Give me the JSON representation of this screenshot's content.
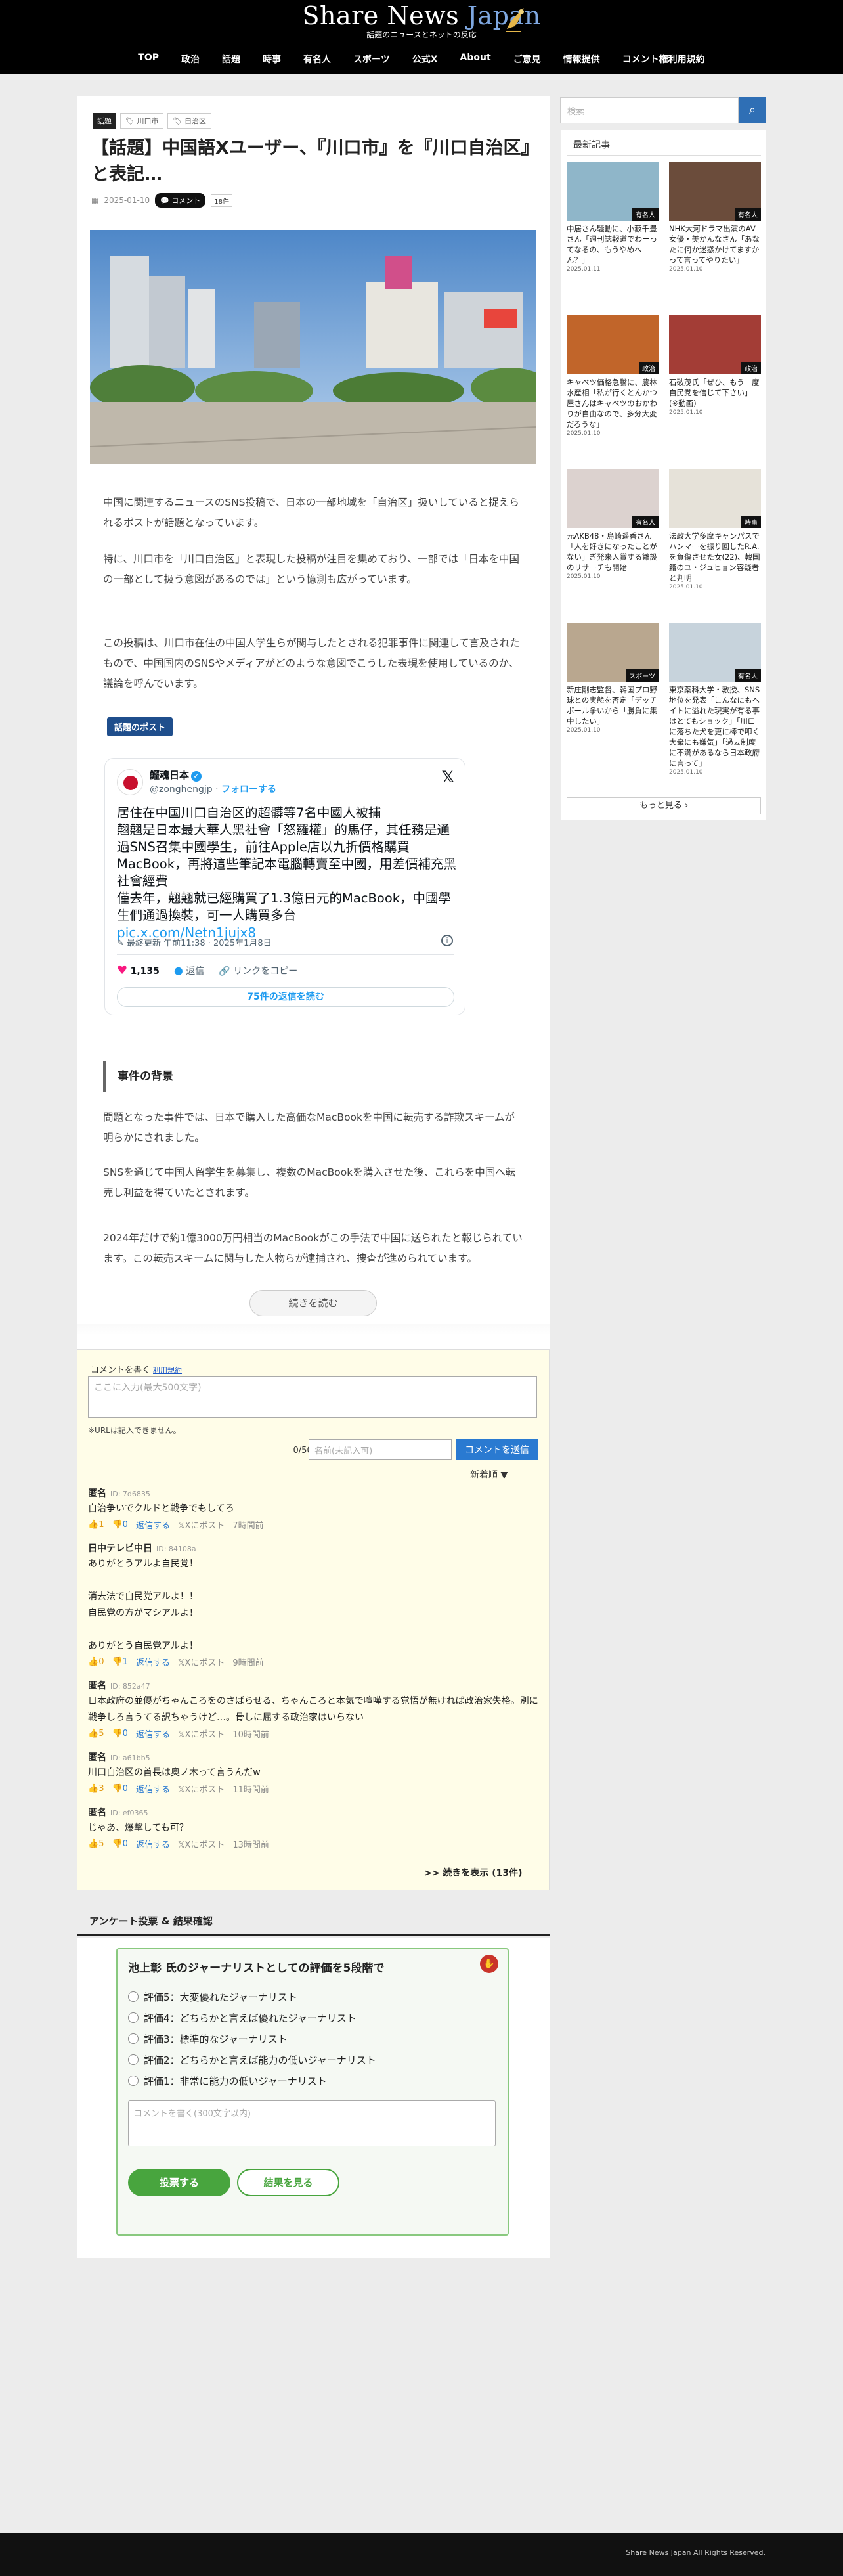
{
  "site": {
    "title_main": "Share News ",
    "title_accent": "Japan",
    "subtitle": "話題のニュースとネットの反応"
  },
  "nav": [
    "TOP",
    "政治",
    "話題",
    "時事",
    "有名人",
    "スポーツ",
    "公式X",
    "About",
    "ご意見",
    "情報提供",
    "コメント権利用規約"
  ],
  "article": {
    "category": "話題",
    "tags": [
      "川口市",
      "自治区"
    ],
    "title": "【話題】中国語Xユーザー、『川口市』を『川口自治区』と表記…",
    "date": "2025-01-10",
    "comment_label": "コメント",
    "comment_count": "18件",
    "paragraphs": [
      "中国に関連するニュースのSNS投稿で、日本の一部地域を「自治区」扱いしていると捉えられるポストが話題となっています。",
      "特に、川口市を「川口自治区」と表現した投稿が注目を集めており、一部では「日本を中国の一部として扱う意図があるのでは」という憶測も広がっています。",
      "この投稿は、川口市在住の中国人学生らが関与したとされる犯罪事件に関連して言及されたもので、中国国内のSNSやメディアがどのような意図でこうした表現を使用しているのか、議論を呼んでいます。"
    ],
    "topic_label": "話題のポスト",
    "section_heading": "事件の背景",
    "background_paragraphs": [
      "問題となった事件では、日本で購入した高価なMacBookを中国に転売する詐欺スキームが明らかにされました。",
      "SNSを通じて中国人留学生を募集し、複数のMacBookを購入させた後、これらを中国へ転売し利益を得ていたとされます。",
      "2024年だけで約1億3000万円相当のMacBookがこの手法で中国に送られたと報じられています。この転売スキームに関与した人物らが逮捕され、捜査が進められています。"
    ],
    "read_more": "続きを読む"
  },
  "tweet": {
    "name": "鰹魂日本",
    "handle": "@zonghengjp",
    "follow": "フォローする",
    "text": "居住在中国川口自治区的超髒等7名中國人被捕\n翹翹是日本最大華人黑社會「怒羅權」的馬仔，其任務是通過SNS召集中國學生，前往Apple店以九折價格購買MacBook，再將這些筆記本電腦轉賣至中國，用差價補充黑社會經費\n僅去年，翹翹就已經購買了1.3億日元的MacBook，中國學生們通過換裝，可一人購買多台",
    "link": "pic.x.com/Netn1jujx8",
    "time": "最終更新 午前11:38 · 2025年1月8日",
    "likes": "1,135",
    "reply": "返信",
    "copy_link": "リンクをコピー",
    "read_replies": "75件の返信を読む"
  },
  "comments": {
    "header": "コメントを書く",
    "rules_link": "利用規約",
    "placeholder": "ここに入力(最大500文字)",
    "url_note": "※URLは記入できません。",
    "counter": "0/500",
    "name_placeholder": "名前(未記入可)",
    "submit": "コメントを送信",
    "sort": "新着順 ▼",
    "reply_label": "返信する",
    "xpost_label": "Xにポスト",
    "items": [
      {
        "name": "匿名",
        "id": "ID: 7d6835",
        "body": "自治争いでクルドと戦争でもしてろ",
        "up": "1",
        "down": "0",
        "time": "7時間前"
      },
      {
        "name": "日中テレビ中日",
        "id": "ID: 84108a",
        "body": "ありがとうアルよ自民党！\n\n消去法で自民党アルよ！！\n自民党の方がマシアルよ！\n\nありがとう自民党アルよ！",
        "up": "0",
        "down": "1",
        "time": "9時間前"
      },
      {
        "name": "匿名",
        "id": "ID: 852a47",
        "body": "日本政府の並優がちゃんころをのさばらせる、ちゃんころと本気で喧嘩する覚悟が無ければ政治家失格。別に戦争しろ言うてる訳ちゃうけど…。骨しに屈する政治家はいらない",
        "up": "5",
        "down": "0",
        "time": "10時間前"
      },
      {
        "name": "匿名",
        "id": "ID: a61bb5",
        "body": "川口自治区の首長は奥ノ木って言うんだw",
        "up": "3",
        "down": "0",
        "time": "11時間前"
      },
      {
        "name": "匿名",
        "id": "ID: ef0365",
        "body": "じゃあ、爆撃しても可？",
        "up": "5",
        "down": "0",
        "time": "13時間前"
      }
    ],
    "more": ">> 続きを表示 (13件)"
  },
  "poll": {
    "heading": "アンケート投票 & 結果確認",
    "question": "池上彰 氏のジャーナリストとしての評価を5段階で",
    "options": [
      "評価5：大変優れたジャーナリスト",
      "評価4：どちらかと言えば優れたジャーナリスト",
      "評価3：標準的なジャーナリスト",
      "評価2：どちらかと言えば能力の低いジャーナリスト",
      "評価1：非常に能力の低いジャーナリスト"
    ],
    "comment_placeholder": "コメントを書く(300文字以内)",
    "vote": "投票する",
    "results": "結果を見る"
  },
  "sidebar": {
    "search_placeholder": "検索",
    "recent_heading": "最新記事",
    "articles": [
      {
        "title": "中居さん騒動に、小藪千豊さん「週刊誌報道でわーってなるの、もうやめへん？」",
        "date": "2025.01.11",
        "cat": "有名人",
        "color": "#8fb6c9"
      },
      {
        "title": "NHK大河ドラマ出演のAV女優・美かんなさん「あなたに何か迷惑かけてますかって言ってやりたい」",
        "date": "2025.01.10",
        "cat": "有名人",
        "color": "#6b4c3b"
      },
      {
        "title": "キャベツ価格急騰に、農林水産相「私が行くとんかつ屋さんはキャベツのおかわりが自由なので、多分大変だろうな」",
        "date": "2025.01.10",
        "cat": "政治",
        "color": "#c1652a"
      },
      {
        "title": "石破茂氏「ぜひ、もう一度自民党を信じて下さい」(※動画)",
        "date": "2025.01.10",
        "cat": "政治",
        "color": "#a33d36"
      },
      {
        "title": "元AKB48・島崎遥香さん「人を好きになったことがない」ぎ発来入賞する雛設のリサーチも開始",
        "date": "2025.01.10",
        "cat": "有名人",
        "color": "#dcd2cf"
      },
      {
        "title": "法政大学多摩キャンパスでハンマーを振り回したR.A.を負傷させた女(22)、韓国籍のユ・ジュヒョン容疑者と判明",
        "date": "2025.01.10",
        "cat": "時事",
        "color": "#e6e2d9"
      },
      {
        "title": "新庄剛志監督、韓国プロ野球との実態を否定「デッチボール争いから「勝負に集中したい」",
        "date": "2025.01.10",
        "cat": "スポーツ",
        "color": "#b9a78f"
      },
      {
        "title": "東京薬科大学・教授、SNS地位を発表「こんなにもヘイトに溢れた現実が有る事はとてもショック」「川口に落ちた犬を更に棒で叩く大衆にも嫌気」「過去制度に不満があるなら日本政府に言って」",
        "date": "2025.01.10",
        "cat": "有名人",
        "color": "#c7d3dc"
      }
    ],
    "more": "もっと見る"
  },
  "footer": "Share News Japan All Rights Reserved."
}
